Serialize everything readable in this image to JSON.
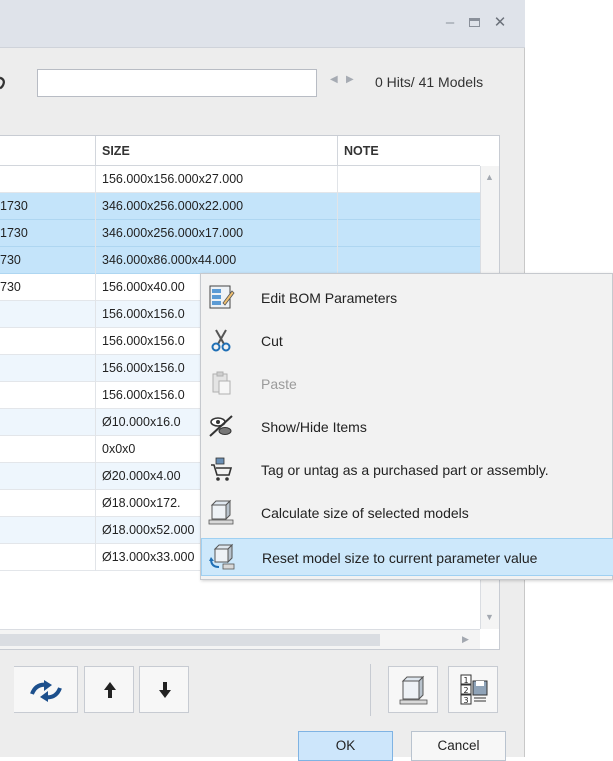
{
  "window": {
    "minimize_glyph": "–",
    "close_glyph": "✕"
  },
  "search": {
    "value": "",
    "placeholder": "",
    "hits_text": "0 Hits/ 41 Models"
  },
  "table": {
    "columns": [
      "",
      "SIZE",
      "NOTE"
    ],
    "rows": [
      {
        "c0": "",
        "size": "156.000x156.000x27.000",
        "note": "",
        "state": "normal"
      },
      {
        "c0": "1730",
        "size": "346.000x256.000x22.000",
        "note": "",
        "state": "selected"
      },
      {
        "c0": "1730",
        "size": "346.000x256.000x17.000",
        "note": "",
        "state": "selected"
      },
      {
        "c0": "730",
        "size": "346.000x86.000x44.000",
        "note": "",
        "state": "selected"
      },
      {
        "c0": "730",
        "size": "156.000x40.00",
        "note": "",
        "state": "normal"
      },
      {
        "c0": "",
        "size": "156.000x156.0",
        "note": "",
        "state": "alt"
      },
      {
        "c0": "",
        "size": "156.000x156.0",
        "note": "",
        "state": "normal"
      },
      {
        "c0": "",
        "size": "156.000x156.0",
        "note": "",
        "state": "alt"
      },
      {
        "c0": "",
        "size": "156.000x156.0",
        "note": "",
        "state": "normal"
      },
      {
        "c0": "",
        "size": "Ø10.000x16.0",
        "note": "",
        "state": "alt"
      },
      {
        "c0": "",
        "size": "0x0x0",
        "note": "",
        "state": "normal"
      },
      {
        "c0": "",
        "size": "Ø20.000x4.00",
        "note": "",
        "state": "alt"
      },
      {
        "c0": "",
        "size": "Ø18.000x172.",
        "note": "",
        "state": "normal"
      },
      {
        "c0": "",
        "size": "Ø18.000x52.000",
        "note": "",
        "state": "alt"
      },
      {
        "c0": "",
        "size": "Ø13.000x33.000",
        "note": "",
        "state": "normal"
      }
    ]
  },
  "context_menu": {
    "items": [
      {
        "label": "Edit BOM Parameters",
        "icon": "edit-bom-icon",
        "enabled": true,
        "hovered": false
      },
      {
        "label": "Cut",
        "icon": "scissors-icon",
        "enabled": true,
        "hovered": false
      },
      {
        "label": "Paste",
        "icon": "paste-icon",
        "enabled": false,
        "hovered": false
      },
      {
        "label": "Show/Hide Items",
        "icon": "eye-hide-icon",
        "enabled": true,
        "hovered": false
      },
      {
        "label": "Tag or untag as a purchased part or assembly.",
        "icon": "cart-icon",
        "enabled": true,
        "hovered": false
      },
      {
        "label": "Calculate size of selected models",
        "icon": "calculate-size-icon",
        "enabled": true,
        "hovered": false
      },
      {
        "label": "Reset model size to current parameter value",
        "icon": "reset-size-icon",
        "enabled": true,
        "hovered": true
      }
    ]
  },
  "buttons": {
    "ok": "OK",
    "cancel": "Cancel"
  },
  "colors": {
    "selection": "#c4e4fa",
    "alt_row": "#eef6fd",
    "hover": "#cde8fb",
    "ok_button": "#cde6fb"
  }
}
